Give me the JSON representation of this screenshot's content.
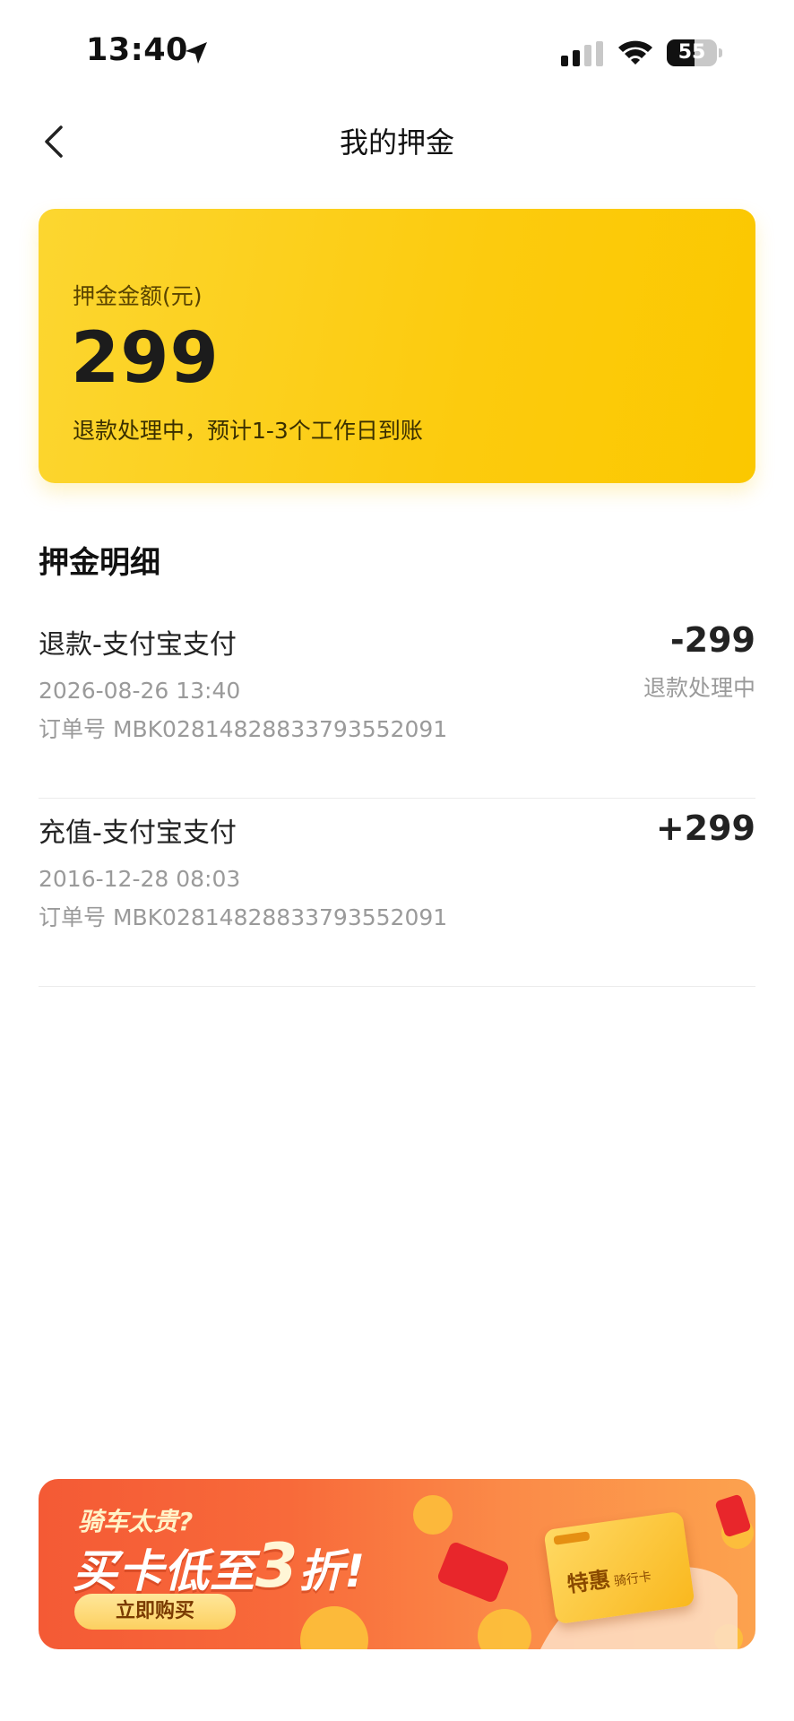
{
  "status_bar": {
    "time": "13:40",
    "battery": "55",
    "battery_level": 0.55
  },
  "nav": {
    "title": "我的押金"
  },
  "deposit": {
    "label": "押金金额(元)",
    "amount": "299",
    "status": "退款处理中，预计1-3个工作日到账"
  },
  "details": {
    "title": "押金明细",
    "records": [
      {
        "title": "退款-支付宝支付",
        "date": "2026-08-26 13:40",
        "order": "订单号 MBK02814828833793552091",
        "amount": "-299",
        "status": "退款处理中"
      },
      {
        "title": "充值-支付宝支付",
        "date": "2016-12-28 08:03",
        "order": "订单号 MBK02814828833793552091",
        "amount": "+299"
      }
    ]
  },
  "promo": {
    "subtitle": "骑车太贵?",
    "headline_pre": "买卡低至",
    "headline_num": "3",
    "headline_post": "折!",
    "button": "立即购买",
    "card_text": "特惠",
    "card_small": "骑行卡"
  },
  "colors": {
    "accent": "#FCCB0E",
    "promo": "#F45A35"
  }
}
